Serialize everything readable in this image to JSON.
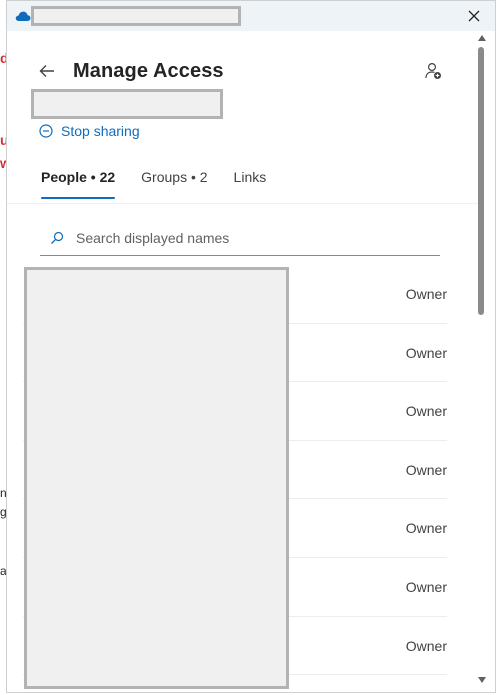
{
  "background": {
    "glyphs": [
      "d",
      "u",
      "w",
      "n",
      "g",
      "a"
    ]
  },
  "window": {
    "close_label": "✕"
  },
  "header": {
    "title": "Manage Access",
    "stop_sharing": "Stop sharing"
  },
  "tabs": [
    {
      "label": "People • 22",
      "active": true
    },
    {
      "label": "Groups • 2",
      "active": false
    },
    {
      "label": "Links",
      "active": false
    }
  ],
  "search": {
    "placeholder": "Search displayed names",
    "value": ""
  },
  "people": [
    {
      "role": "Owner"
    },
    {
      "role": "Owner"
    },
    {
      "role": "Owner"
    },
    {
      "role": "Owner"
    },
    {
      "role": "Owner"
    },
    {
      "role": "Owner"
    },
    {
      "role": "Owner"
    }
  ],
  "colors": {
    "accent": "#0f6cbd",
    "redaction_fill": "#f0f0f0",
    "redaction_border": "#b3b3b3",
    "background_red_text": "#d13438"
  },
  "icons": {
    "app": "onedrive-cloud-icon",
    "close": "close-icon",
    "back": "back-arrow-icon",
    "share_user": "share-with-people-icon",
    "stop_sharing": "stop-circle-icon",
    "search": "search-icon"
  }
}
